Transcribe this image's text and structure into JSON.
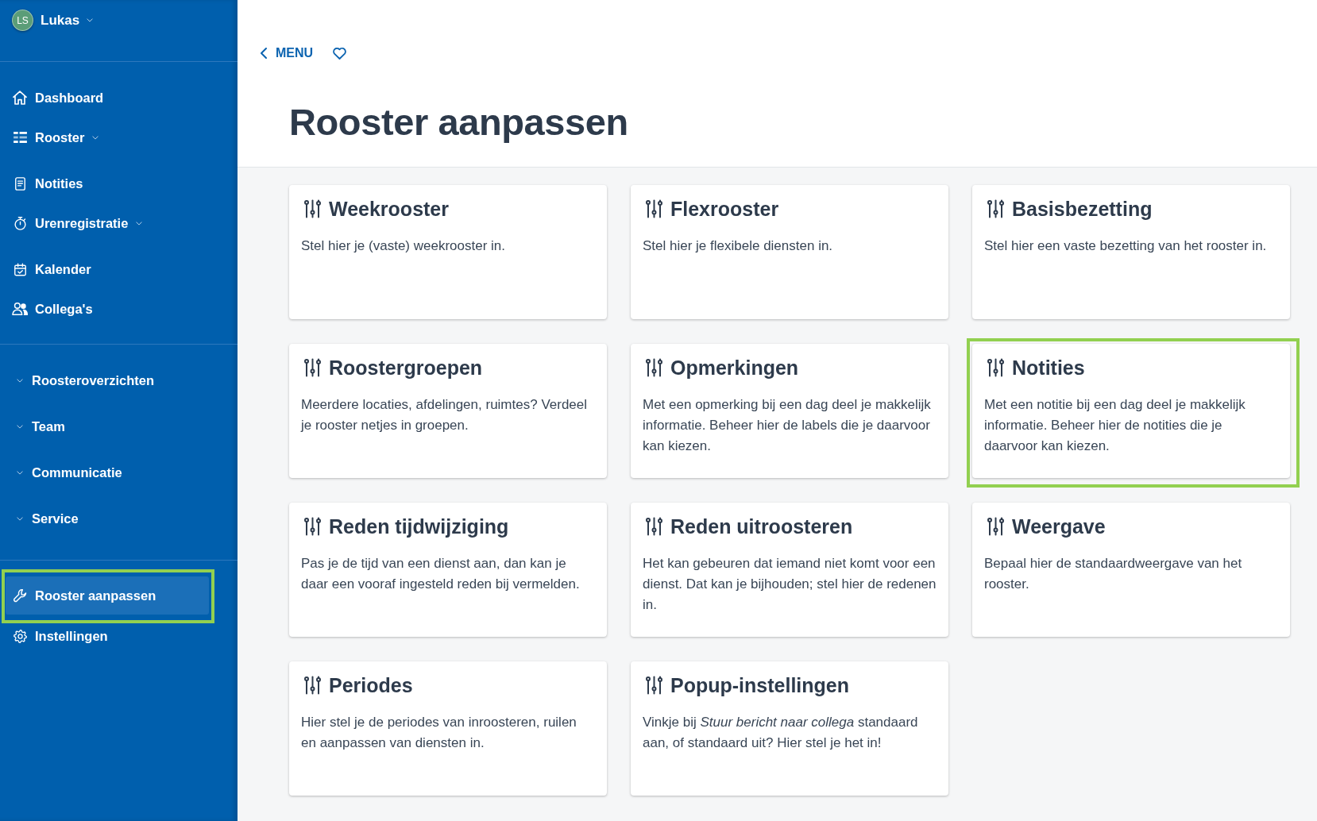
{
  "sidebar": {
    "user": {
      "initials": "LS",
      "name": "Lukas"
    },
    "main_nav": [
      {
        "label": "Dashboard",
        "kind": "link",
        "selected": false
      },
      {
        "label": "Rooster",
        "kind": "dropdown",
        "selected": false
      },
      {
        "label": "Notities",
        "kind": "link",
        "selected": false
      },
      {
        "label": "Urenregistratie",
        "kind": "dropdown",
        "selected": false
      },
      {
        "label": "Kalender",
        "kind": "link",
        "selected": false
      },
      {
        "label": "Collega's",
        "kind": "link",
        "selected": false
      }
    ],
    "groups": [
      {
        "label": "Roosteroverzichten"
      },
      {
        "label": "Team"
      },
      {
        "label": "Communicatie"
      },
      {
        "label": "Service"
      }
    ],
    "bottom_nav": [
      {
        "label": "Rooster aanpassen",
        "selected": true,
        "highlighted": true
      },
      {
        "label": "Instellingen",
        "selected": false,
        "highlighted": false
      }
    ]
  },
  "header": {
    "back_link": "MENU",
    "title": "Rooster aanpassen"
  },
  "cards": [
    {
      "title": "Weekrooster",
      "description": "Stel hier je (vaste) weekrooster in.",
      "highlighted": false
    },
    {
      "title": "Flexrooster",
      "description": "Stel hier je flexibele diensten in.",
      "highlighted": false
    },
    {
      "title": "Basisbezetting",
      "description": "Stel hier een vaste bezetting van het rooster in.",
      "highlighted": false
    },
    {
      "title": "Roostergroepen",
      "description": "Meerdere locaties, afdelingen, ruimtes? Verdeel je rooster netjes in groepen.",
      "highlighted": false
    },
    {
      "title": "Opmerkingen",
      "description": "Met een opmerking bij een dag deel je makkelijk informatie. Beheer hier de labels die je daarvoor kan kiezen.",
      "highlighted": false
    },
    {
      "title": "Notities",
      "description": "Met een notitie bij een dag deel je makkelijk informatie. Beheer hier de notities die je daarvoor kan kiezen.",
      "highlighted": true
    },
    {
      "title": "Reden tijdwijziging",
      "description": "Pas je de tijd van een dienst aan, dan kan je daar een vooraf ingesteld reden bij vermelden.",
      "highlighted": false
    },
    {
      "title": "Reden uitroosteren",
      "description": "Het kan gebeuren dat iemand niet komt voor een dienst. Dat kan je bijhouden; stel hier de redenen in.",
      "highlighted": false
    },
    {
      "title": "Weergave",
      "description": "Bepaal hier de standaardweergave van het rooster.",
      "highlighted": false
    },
    {
      "title": "Periodes",
      "description": "Hier stel je de periodes van inroosteren, ruilen en aanpassen van diensten in.",
      "highlighted": false
    },
    {
      "title": "Popup-instellingen",
      "description": "Vinkje bij *Stuur bericht naar collega* standaard aan, of standaard uit? Hier stel je het in!",
      "highlighted": false
    }
  ]
}
